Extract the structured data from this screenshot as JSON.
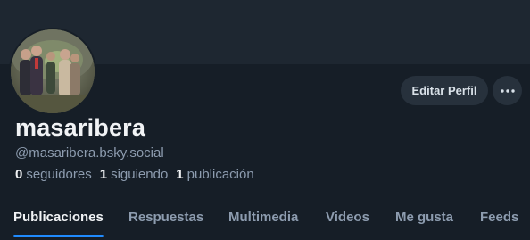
{
  "profile": {
    "display_name": "masaribera",
    "handle": "@masaribera.bsky.social",
    "avatar_alt": "profile-photo"
  },
  "actions": {
    "edit_label": "Editar Perfil",
    "more_icon": "ellipsis-horizontal-icon"
  },
  "stats": {
    "followers_count": "0",
    "followers_label": "seguidores",
    "following_count": "1",
    "following_label": "siguiendo",
    "posts_count": "1",
    "posts_label": "publicación"
  },
  "tabs": [
    {
      "label": "Publicaciones",
      "active": true
    },
    {
      "label": "Respuestas",
      "active": false
    },
    {
      "label": "Multimedia",
      "active": false
    },
    {
      "label": "Videos",
      "active": false
    },
    {
      "label": "Me gusta",
      "active": false
    },
    {
      "label": "Feeds",
      "active": false
    }
  ],
  "colors": {
    "background": "#161e27",
    "banner": "#1e2731",
    "button_bg": "#27313c",
    "text_primary": "#f1f3f5",
    "text_secondary": "#8d9caf",
    "accent": "#208bfe"
  }
}
